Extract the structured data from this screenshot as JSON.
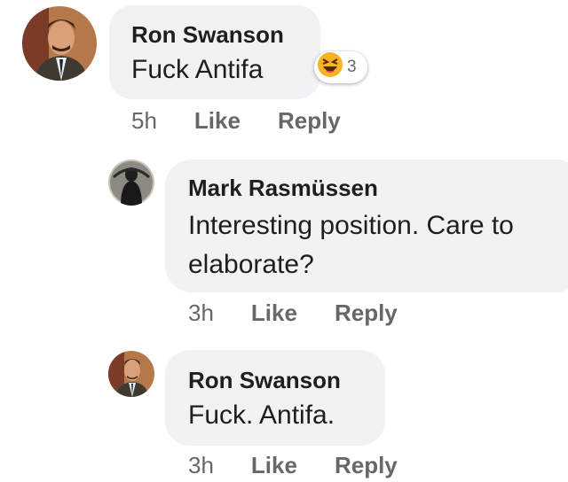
{
  "comments": [
    {
      "author": "Ron Swanson",
      "text": "Fuck Antifa",
      "time": "5h",
      "like": "Like",
      "reply": "Reply",
      "reaction_count": "3",
      "reaction_icon": "haha-emoji-icon"
    },
    {
      "author": "Mark Rasmüssen",
      "text": "Interesting position. Care to elaborate?",
      "time": "3h",
      "like": "Like",
      "reply": "Reply"
    },
    {
      "author": "Ron Swanson",
      "text": "Fuck. Antifa.",
      "time": "3h",
      "like": "Like",
      "reply": "Reply"
    }
  ],
  "colors": {
    "bubble": "#f0f2f5",
    "meta": "#65676b",
    "reaction": "#f7b125"
  }
}
